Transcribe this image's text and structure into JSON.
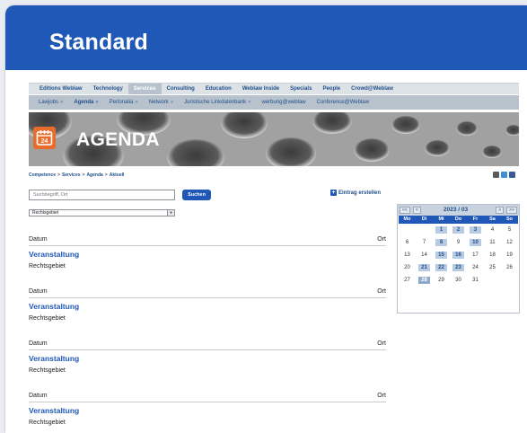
{
  "header": {
    "title": "Standard"
  },
  "main_nav": [
    {
      "label": "Editions Weblaw",
      "active": false
    },
    {
      "label": "Technology",
      "active": false
    },
    {
      "label": "Services",
      "active": true
    },
    {
      "label": "Consulting",
      "active": false
    },
    {
      "label": "Education",
      "active": false
    },
    {
      "label": "Weblaw Inside",
      "active": false
    },
    {
      "label": "Specials",
      "active": false
    },
    {
      "label": "People",
      "active": false
    },
    {
      "label": "Crowd@Weblaw",
      "active": false
    }
  ],
  "sub_nav": [
    {
      "label": "Lawjobs",
      "chevron": "»",
      "active": false
    },
    {
      "label": "Agenda",
      "chevron": "»",
      "active": true
    },
    {
      "label": "Perſonalia",
      "chevron": "»",
      "active": false
    },
    {
      "label": "Network",
      "chevron": "»",
      "active": false
    },
    {
      "label": "Juristische Linkdatenbank",
      "chevron": "»",
      "active": false
    },
    {
      "label": "werbung@weblaw",
      "chevron": "",
      "active": false
    },
    {
      "label": "Conference@Weblaw",
      "chevron": "",
      "active": false
    }
  ],
  "banner": {
    "title": "AGENDA",
    "icon_number": "24",
    "icon": "calendar-icon"
  },
  "breadcrumb": [
    "Competence",
    "Services",
    "Agenda",
    "Aktuell"
  ],
  "breadcrumb_sep": ">",
  "tools": [
    {
      "icon": "print-icon",
      "color": "#5a5a5a"
    },
    {
      "icon": "twitter-icon",
      "color": "#3d8fd6"
    },
    {
      "icon": "facebook-icon",
      "color": "#3b5b98"
    }
  ],
  "search": {
    "placeholder": "Suchbegriff, Ort",
    "button_label": "Suchen"
  },
  "create_entry": {
    "label": "Eintrag erstellen",
    "icon": "+"
  },
  "filter": {
    "selected": "Rechtsgebiet",
    "arrow": "▼"
  },
  "events": [
    {
      "datum": "Datum",
      "ort": "Ort",
      "title": "Veranstaltung",
      "field": "Rechtsgebiet"
    },
    {
      "datum": "Datum",
      "ort": "Ort",
      "title": "Veranstaltung",
      "field": "Rechtsgebiet"
    },
    {
      "datum": "Datum",
      "ort": "Ort",
      "title": "Veranstaltung",
      "field": "Rechtsgebiet"
    },
    {
      "datum": "Datum",
      "ort": "Ort",
      "title": "Veranstaltung",
      "field": "Rechtsgebiet"
    }
  ],
  "calendar": {
    "month_label": "2023 / 03",
    "prev_year": "<<",
    "prev_month": "<",
    "next_month": ">",
    "next_year": ">>",
    "weekdays": [
      "Mo",
      "Di",
      "Mi",
      "Do",
      "Fr",
      "Sa",
      "So"
    ],
    "weeks": [
      [
        "",
        "",
        "1",
        "2",
        "3",
        "4",
        "5"
      ],
      [
        "6",
        "7",
        "8",
        "9",
        "10",
        "11",
        "12"
      ],
      [
        "13",
        "14",
        "15",
        "16",
        "17",
        "18",
        "19"
      ],
      [
        "20",
        "21",
        "22",
        "23",
        "24",
        "25",
        "26"
      ],
      [
        "27",
        "28",
        "29",
        "30",
        "31",
        "",
        ""
      ]
    ],
    "highlighted": [
      "1",
      "2",
      "3",
      "8",
      "10",
      "15",
      "16",
      "21",
      "22",
      "23",
      "28"
    ],
    "today": "28"
  },
  "colors": {
    "accent": "#1f58b6",
    "icon_orange": "#e86d2c"
  }
}
